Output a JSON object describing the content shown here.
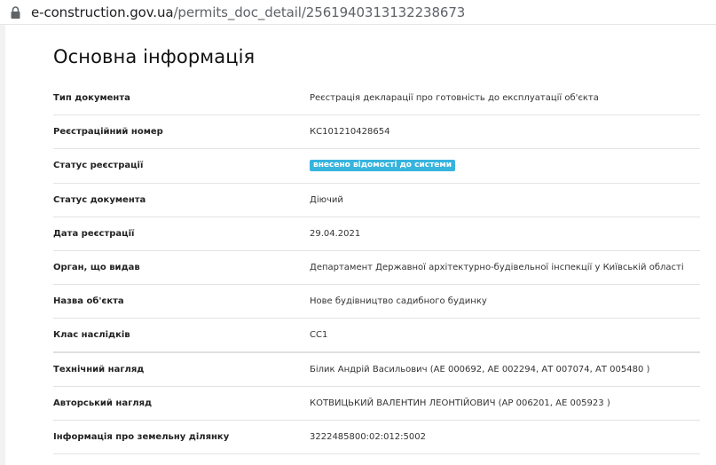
{
  "browser": {
    "url_domain": "e-construction.gov.ua",
    "url_path": "/permits_doc_detail/2561940313132238673"
  },
  "section": {
    "title": "Основна інформація"
  },
  "rows": [
    {
      "label": "Тип документа",
      "value": "Реєстрація декларації про готовність до експлуатації об'єкта"
    },
    {
      "label": "Реєстраційний номер",
      "value": "КС101210428654"
    },
    {
      "label": "Статус реєстрації",
      "badge": "внесено відомості до системи"
    },
    {
      "label": "Статус документа",
      "value": "Діючий"
    },
    {
      "label": "Дата реєстрації",
      "value": "29.04.2021"
    },
    {
      "label": "Орган, що видав",
      "value": "Департамент Державної архітектурно-будівельної інспекції у Київській області"
    },
    {
      "label": "Назва об'єкта",
      "value": "Нове будівництво садибного будинку"
    },
    {
      "label": "Клас наслідків",
      "value": "СС1"
    },
    {
      "label": "Технічний нагляд",
      "value": "Білик Андрій Васильович (АЕ 000692, АЕ 002294, АТ 007074, АТ 005480 )"
    },
    {
      "label": "Авторський нагляд",
      "value": "КОТВИЦЬКИЙ ВАЛЕНТИН ЛЕОНТІЙОВИЧ (АР 006201, АЕ 005923 )"
    },
    {
      "label": "Інформація про земельну ділянку",
      "value": "3222485800:02:012:5002"
    }
  ],
  "colors": {
    "badge": "#36b4de"
  }
}
